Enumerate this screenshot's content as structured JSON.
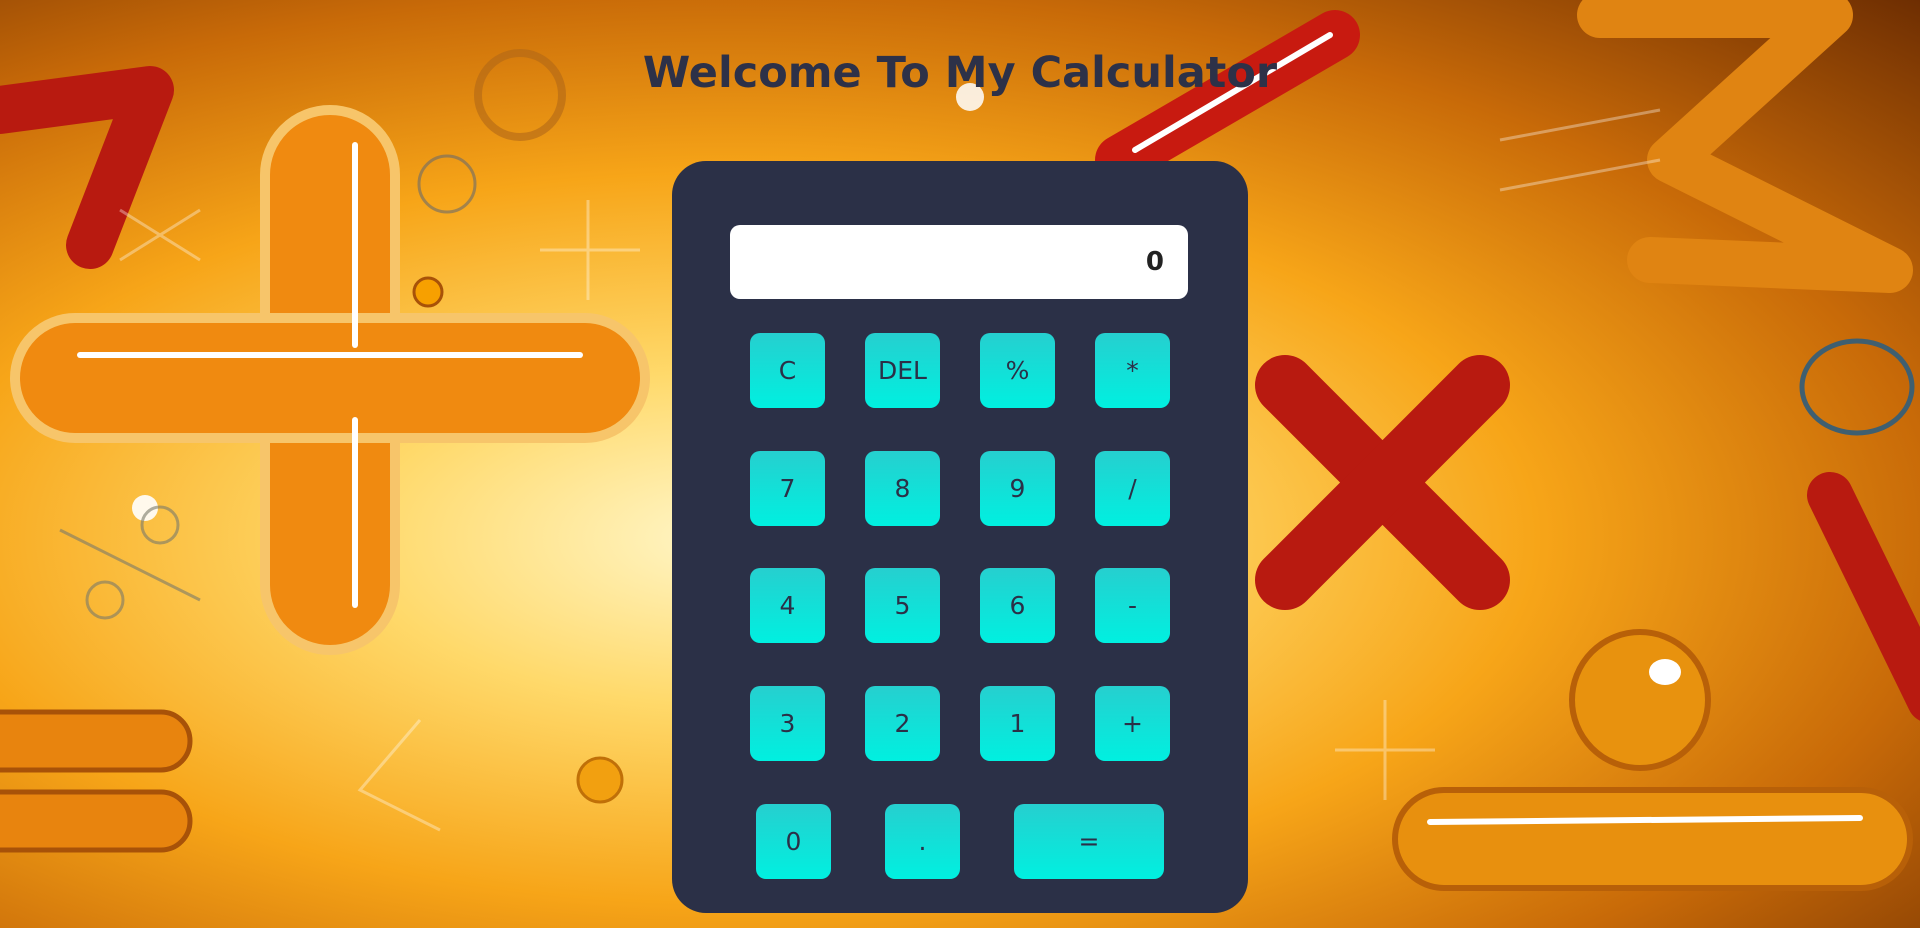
{
  "page": {
    "title": "Welcome To My Calculator"
  },
  "calculator": {
    "display_value": "0",
    "keys": {
      "clear": "C",
      "delete": "DEL",
      "percent": "%",
      "multiply": "*",
      "seven": "7",
      "eight": "8",
      "nine": "9",
      "divide": "/",
      "four": "4",
      "five": "5",
      "six": "6",
      "subtract": "-",
      "three": "3",
      "two": "2",
      "one": "1",
      "add": "+",
      "zero": "0",
      "decimal": ".",
      "equals": "="
    }
  },
  "colors": {
    "calculator_body": "#2b3047",
    "key_gradient_top": "#26cfcf",
    "key_gradient_bottom": "#00f0e0",
    "title_text": "#2d3148",
    "background_center": "#fff6c8",
    "background_edge": "#6e2e02"
  }
}
